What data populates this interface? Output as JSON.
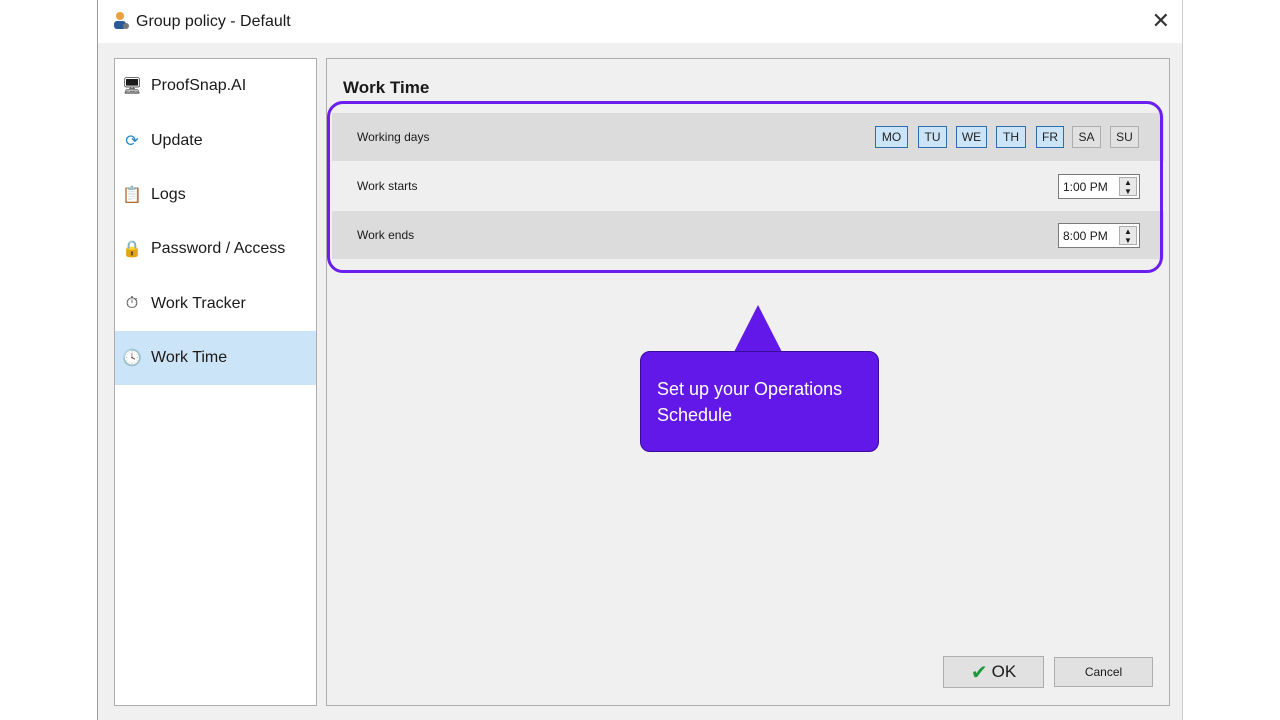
{
  "window": {
    "title": "Group policy - Default",
    "close": "✕"
  },
  "sidebar": {
    "items": [
      {
        "label": "ProofSnap.AI",
        "icon": "🖥"
      },
      {
        "label": "Update",
        "icon": "⟳"
      },
      {
        "label": "Logs",
        "icon": "📋"
      },
      {
        "label": "Password / Access",
        "icon": "🔒"
      },
      {
        "label": "Work Tracker",
        "icon": "⏱"
      },
      {
        "label": "Work Time",
        "icon": "🕓"
      }
    ],
    "selected": "Work Time"
  },
  "main": {
    "heading": "Work Time",
    "working_days": {
      "label": "Working days",
      "days": [
        {
          "label": "MO",
          "on": true
        },
        {
          "label": "TU",
          "on": true
        },
        {
          "label": "WE",
          "on": true
        },
        {
          "label": "TH",
          "on": true
        },
        {
          "label": "FR",
          "on": true
        },
        {
          "label": "SA",
          "on": false
        },
        {
          "label": "SU",
          "on": false
        }
      ]
    },
    "work_starts": {
      "label": "Work starts",
      "value": "1:00 PM"
    },
    "work_ends": {
      "label": "Work ends",
      "value": "8:00 PM"
    }
  },
  "callout": {
    "text": "Set up your Operations Schedule"
  },
  "buttons": {
    "ok": "OK",
    "cancel": "Cancel"
  },
  "colors": {
    "accent": "#6118e8",
    "selection": "#cce4f7"
  }
}
